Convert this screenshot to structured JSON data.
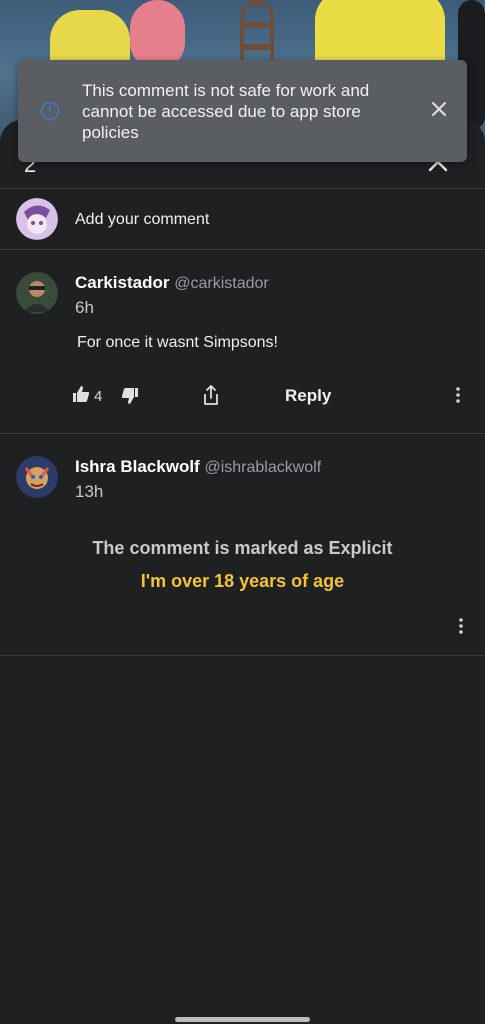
{
  "toast": {
    "message": "This comment is not safe for work and cannot be accessed due to app store policies"
  },
  "sheet": {
    "comment_count": "2"
  },
  "composer": {
    "placeholder": "Add your comment"
  },
  "comments": [
    {
      "author": "Carkistador",
      "handle": "@carkistador",
      "time": "6h",
      "text": "For once it wasnt Simpsons!",
      "likes": "4",
      "reply_label": "Reply"
    },
    {
      "author": "Ishra Blackwolf",
      "handle": "@ishrablackwolf",
      "time": "13h",
      "explicit_notice": "The comment is marked as Explicit",
      "age_confirm": "I'm over 18 years of age"
    }
  ],
  "colors": {
    "background": "#1f2022",
    "toast": "#5a5e63",
    "accent_yellow": "#f4c430"
  },
  "icons": [
    "info-icon",
    "close-icon",
    "chevron-up-icon",
    "thumbs-up-icon",
    "thumbs-down-icon",
    "share-icon",
    "more-vertical-icon"
  ]
}
